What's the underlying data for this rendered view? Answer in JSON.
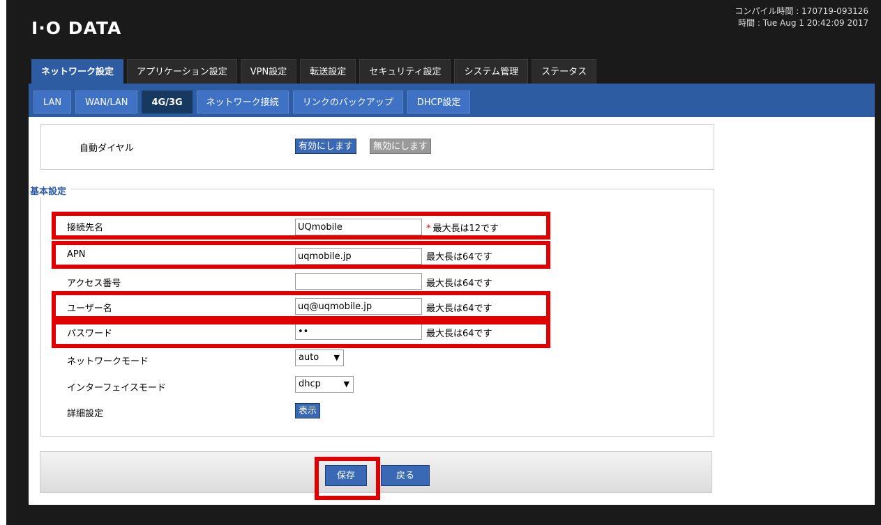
{
  "header": {
    "logo": "I·O DATA",
    "compile_time": "コンパイル時間 : 170719-093126",
    "time": "時間 : Tue Aug 1 20:42:09 2017"
  },
  "tabs": [
    {
      "label": "ネットワーク設定",
      "active": true
    },
    {
      "label": "アプリケーション設定"
    },
    {
      "label": "VPN設定"
    },
    {
      "label": "転送設定"
    },
    {
      "label": "セキュリティ設定"
    },
    {
      "label": "システム管理"
    },
    {
      "label": "ステータス"
    }
  ],
  "subtabs": [
    {
      "label": "LAN"
    },
    {
      "label": "WAN/LAN"
    },
    {
      "label": "4G/3G",
      "active": true
    },
    {
      "label": "ネットワーク接続"
    },
    {
      "label": "リンクのバックアップ"
    },
    {
      "label": "DHCP設定"
    }
  ],
  "auto_dial": {
    "label": "自動ダイヤル",
    "enable": "有効にします",
    "disable": "無効にします"
  },
  "basic": {
    "legend": "基本設定",
    "rows": [
      {
        "label": "接続先名",
        "value": "UQmobile",
        "hint": "最大長は12です",
        "required": true
      },
      {
        "label": "APN",
        "value": "uqmobile.jp",
        "hint": "最大長は64です"
      },
      {
        "label": "アクセス番号",
        "value": "",
        "hint": "最大長は64です"
      },
      {
        "label": "ユーザー名",
        "value": "uq@uqmobile.jp",
        "hint": "最大長は64です"
      },
      {
        "label": "パスワード",
        "value": "••",
        "hint": "最大長は64です"
      }
    ],
    "network_mode": {
      "label": "ネットワークモード",
      "value": "auto"
    },
    "interface_mode": {
      "label": "インターフェイスモード",
      "value": "dhcp"
    },
    "detail": {
      "label": "詳細設定",
      "button": "表示"
    }
  },
  "footer": {
    "save": "保存",
    "back": "戻る"
  },
  "colors": {
    "accent": "#2e5ca3",
    "highlight": "#e00000"
  }
}
